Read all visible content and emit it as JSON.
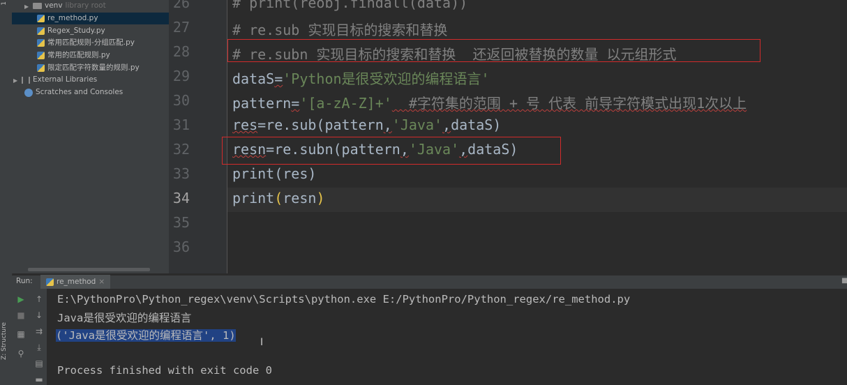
{
  "left_strip": {
    "tab1": "1",
    "structure_tab": "Z: Structure"
  },
  "project_tree": [
    {
      "label": "venv",
      "hint": "library root",
      "type": "folder",
      "indent": 1,
      "expanded": false
    },
    {
      "label": "re_method.py",
      "type": "py",
      "indent": 2,
      "selected": true
    },
    {
      "label": "Regex_Study.py",
      "type": "py",
      "indent": 2
    },
    {
      "label": "常用匹配规则-分组匹配.py",
      "type": "py",
      "indent": 2
    },
    {
      "label": "常用的匹配规则.py",
      "type": "py",
      "indent": 2
    },
    {
      "label": "限定匹配字符数量的规则.py",
      "type": "py",
      "indent": 2
    },
    {
      "label": "External Libraries",
      "type": "lib",
      "indent": 0,
      "expanded": false
    },
    {
      "label": "Scratches and Consoles",
      "type": "scratch",
      "indent": 0
    }
  ],
  "editor": {
    "line_numbers": [
      "26",
      "27",
      "28",
      "29",
      "30",
      "31",
      "32",
      "33",
      "34",
      "35",
      "36"
    ],
    "current_line": "34",
    "lines": {
      "l26": "# print(reobj.findall(data))",
      "l27": "# re.sub 实现目标的搜索和替换",
      "l28": "# re.subn 实现目标的搜索和替换  还返回被替换的数量 以元组形式",
      "l29_a": "dataS",
      "l29_b": "=",
      "l29_c": "'Python是很受欢迎的编程语言'",
      "l30_a": "pattern",
      "l30_b": "=",
      "l30_c": "'[a-zA-Z]+'",
      "l30_d": "  #字符集的范围 + 号 代表 前导字符模式出现1次以上",
      "l31_a": "res",
      "l31_b": "=re.sub(pattern",
      "l31_c": ",",
      "l31_d": "'Java'",
      "l31_e": ",",
      "l31_f": "dataS)",
      "l32_a": "resn",
      "l32_b": "=re.subn(pattern",
      "l32_c": ",",
      "l32_d": "'Java'",
      "l32_e": ",",
      "l32_f": "dataS)",
      "l33": "print(res)",
      "l34_a": "print",
      "l34_b": "(",
      "l34_c": "resn",
      "l34_d": ")"
    }
  },
  "run_panel": {
    "label": "Run:",
    "tab_label": "re_method",
    "tab_close": "×",
    "console": {
      "command": "E:\\PythonPro\\Python_regex\\venv\\Scripts\\python.exe E:/PythonPro/Python_regex/re_method.py",
      "output1": "Java是很受欢迎的编程语言",
      "output2": "('Java是很受欢迎的编程语言', 1)",
      "exit": "Process finished with exit code 0"
    }
  },
  "colors": {
    "highlight_box": "#d22b2b",
    "selection": "#214283",
    "string": "#6a8759",
    "comment": "#808080"
  }
}
